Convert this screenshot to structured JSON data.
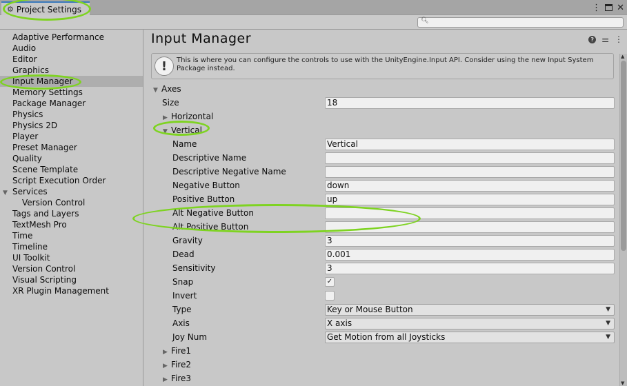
{
  "window": {
    "tab_title": "Project Settings",
    "tab_icon": "gear-icon",
    "controls": [
      "more-icon",
      "maximize-icon",
      "close-icon"
    ]
  },
  "search": {
    "placeholder": "",
    "value": ""
  },
  "sidebar": {
    "items": [
      {
        "label": "Adaptive Performance"
      },
      {
        "label": "Audio"
      },
      {
        "label": "Editor"
      },
      {
        "label": "Graphics"
      },
      {
        "label": "Input Manager",
        "selected": true
      },
      {
        "label": "Memory Settings"
      },
      {
        "label": "Package Manager"
      },
      {
        "label": "Physics"
      },
      {
        "label": "Physics 2D"
      },
      {
        "label": "Player"
      },
      {
        "label": "Preset Manager"
      },
      {
        "label": "Quality"
      },
      {
        "label": "Scene Template"
      },
      {
        "label": "Script Execution Order"
      },
      {
        "label": "Services",
        "expanded": true
      },
      {
        "label": "Version Control",
        "child": true
      },
      {
        "label": "Tags and Layers"
      },
      {
        "label": "TextMesh Pro"
      },
      {
        "label": "Time"
      },
      {
        "label": "Timeline"
      },
      {
        "label": "UI Toolkit"
      },
      {
        "label": "Version Control"
      },
      {
        "label": "Visual Scripting"
      },
      {
        "label": "XR Plugin Management"
      }
    ]
  },
  "main": {
    "title": "Input Manager",
    "help_box": "This is where you can configure the controls to use with the UnityEngine.Input API. Consider using the new Input System Package instead.",
    "axes_label": "Axes",
    "size_label": "Size",
    "size_value": "18",
    "horizontal_label": "Horizontal",
    "vertical_label": "Vertical",
    "fields": {
      "name": {
        "label": "Name",
        "value": "Vertical"
      },
      "descriptive_name": {
        "label": "Descriptive Name",
        "value": ""
      },
      "descriptive_negative_name": {
        "label": "Descriptive Negative Name",
        "value": ""
      },
      "negative_button": {
        "label": "Negative Button",
        "value": "down"
      },
      "positive_button": {
        "label": "Positive Button",
        "value": "up"
      },
      "alt_negative_button": {
        "label": "Alt Negative Button",
        "value": ""
      },
      "alt_positive_button": {
        "label": "Alt Positive Button",
        "value": ""
      },
      "gravity": {
        "label": "Gravity",
        "value": "3"
      },
      "dead": {
        "label": "Dead",
        "value": "0.001"
      },
      "sensitivity": {
        "label": "Sensitivity",
        "value": "3"
      },
      "snap": {
        "label": "Snap",
        "checked": true,
        "mark": "✓"
      },
      "invert": {
        "label": "Invert",
        "checked": false,
        "mark": ""
      },
      "type": {
        "label": "Type",
        "value": "Key or Mouse Button"
      },
      "axis": {
        "label": "Axis",
        "value": "X axis"
      },
      "joy_num": {
        "label": "Joy Num",
        "value": "Get Motion from all Joysticks"
      }
    },
    "collapsed_axes": [
      "Fire1",
      "Fire2",
      "Fire3"
    ]
  },
  "annotation_color": "#7ed321"
}
